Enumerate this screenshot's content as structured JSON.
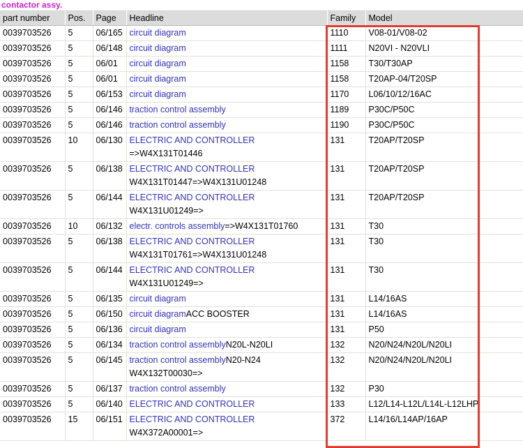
{
  "page_title": "contactor assy.",
  "highlight": {
    "name": "family-model-highlight",
    "color": "#e03c31"
  },
  "table": {
    "columns": [
      {
        "key": "part_number",
        "label": "part number"
      },
      {
        "key": "pos",
        "label": "Pos."
      },
      {
        "key": "page",
        "label": "Page"
      },
      {
        "key": "headline",
        "label": "Headline"
      },
      {
        "key": "family",
        "label": "Family"
      },
      {
        "key": "model",
        "label": "Model"
      }
    ],
    "rows": [
      {
        "part_number": "0039703526",
        "pos": "5",
        "page": "06/165",
        "headline_link": "circuit diagram",
        "headline_suffix": "",
        "headline_line2": "",
        "family": "1110",
        "model": "V08-01/V08-02"
      },
      {
        "part_number": "0039703526",
        "pos": "5",
        "page": "06/148",
        "headline_link": "circuit diagram",
        "headline_suffix": "",
        "headline_line2": "",
        "family": "1111",
        "model": "N20VI - N20VLI"
      },
      {
        "part_number": "0039703526",
        "pos": "5",
        "page": "06/01",
        "headline_link": "circuit diagram",
        "headline_suffix": "",
        "headline_line2": "",
        "family": "1158",
        "model": "T30/T30AP"
      },
      {
        "part_number": "0039703526",
        "pos": "5",
        "page": "06/01",
        "headline_link": "circuit diagram",
        "headline_suffix": "",
        "headline_line2": "",
        "family": "1158",
        "model": "T20AP-04/T20SP"
      },
      {
        "part_number": "0039703526",
        "pos": "5",
        "page": "06/153",
        "headline_link": "circuit diagram",
        "headline_suffix": "",
        "headline_line2": "",
        "family": "1170",
        "model": "L06/10/12/16AC"
      },
      {
        "part_number": "0039703526",
        "pos": "5",
        "page": "06/146",
        "headline_link": "traction control assembly",
        "headline_suffix": "",
        "headline_line2": "",
        "family": "1189",
        "model": "P30C/P50C"
      },
      {
        "part_number": "0039703526",
        "pos": "5",
        "page": "06/146",
        "headline_link": "traction control assembly",
        "headline_suffix": "",
        "headline_line2": "",
        "family": "1190",
        "model": "P30C/P50C"
      },
      {
        "part_number": "0039703526",
        "pos": "10",
        "page": "06/130",
        "headline_link": "ELECTRIC AND CONTROLLER",
        "headline_suffix": "",
        "headline_line2": "=>W4X131T01446",
        "family": "131",
        "model": "T20AP/T20SP"
      },
      {
        "part_number": "0039703526",
        "pos": "5",
        "page": "06/138",
        "headline_link": "ELECTRIC AND CONTROLLER",
        "headline_suffix": "",
        "headline_line2": "W4X131T01447=>W4X131U01248",
        "family": "131",
        "model": "T20AP/T20SP"
      },
      {
        "part_number": "0039703526",
        "pos": "5",
        "page": "06/144",
        "headline_link": "ELECTRIC AND CONTROLLER",
        "headline_suffix": "",
        "headline_line2": "W4X131U01249=>",
        "family": "131",
        "model": "T20AP/T20SP"
      },
      {
        "part_number": "0039703526",
        "pos": "10",
        "page": "06/132",
        "headline_link": "electr. controls assembly",
        "headline_suffix": "=>W4X131T01760",
        "headline_line2": "",
        "family": "131",
        "model": "T30"
      },
      {
        "part_number": "0039703526",
        "pos": "5",
        "page": "06/138",
        "headline_link": "ELECTRIC AND CONTROLLER",
        "headline_suffix": "",
        "headline_line2": "W4X131T01761=>W4X131U01248",
        "family": "131",
        "model": "T30"
      },
      {
        "part_number": "0039703526",
        "pos": "5",
        "page": "06/144",
        "headline_link": "ELECTRIC AND CONTROLLER",
        "headline_suffix": "",
        "headline_line2": "W4X131U01249=>",
        "family": "131",
        "model": "T30"
      },
      {
        "part_number": "0039703526",
        "pos": "5",
        "page": "06/135",
        "headline_link": "circuit diagram",
        "headline_suffix": "",
        "headline_line2": "",
        "family": "131",
        "model": "L14/16AS"
      },
      {
        "part_number": "0039703526",
        "pos": "5",
        "page": "06/150",
        "headline_link": "circuit diagram",
        "headline_suffix": "ACC BOOSTER",
        "headline_line2": "",
        "family": "131",
        "model": "L14/16AS"
      },
      {
        "part_number": "0039703526",
        "pos": "5",
        "page": "06/136",
        "headline_link": "circuit diagram",
        "headline_suffix": "",
        "headline_line2": "",
        "family": "131",
        "model": "P50"
      },
      {
        "part_number": "0039703526",
        "pos": "5",
        "page": "06/134",
        "headline_link": "traction control assembly",
        "headline_suffix": "N20L-N20LI",
        "headline_line2": "",
        "family": "132",
        "model": "N20/N24/N20L/N20LI"
      },
      {
        "part_number": "0039703526",
        "pos": "5",
        "page": "06/145",
        "headline_link": "traction control assembly",
        "headline_suffix": "N20-N24",
        "headline_line2": "W4X132T00030=>",
        "family": "132",
        "model": "N20/N24/N20L/N20LI"
      },
      {
        "part_number": "0039703526",
        "pos": "5",
        "page": "06/137",
        "headline_link": "traction control assembly",
        "headline_suffix": "",
        "headline_line2": "",
        "family": "132",
        "model": "P30"
      },
      {
        "part_number": "0039703526",
        "pos": "5",
        "page": "06/140",
        "headline_link": "ELECTRIC AND CONTROLLER",
        "headline_suffix": "",
        "headline_line2": "",
        "family": "133",
        "model": "L12/L14-L12L/L14L-L12LHP"
      },
      {
        "part_number": "0039703526",
        "pos": "15",
        "page": "06/151",
        "headline_link": "ELECTRIC AND CONTROLLER",
        "headline_suffix": "",
        "headline_line2": "W4X372A00001=>",
        "family": "372",
        "model": "L14/16/L14AP/16AP"
      }
    ]
  }
}
